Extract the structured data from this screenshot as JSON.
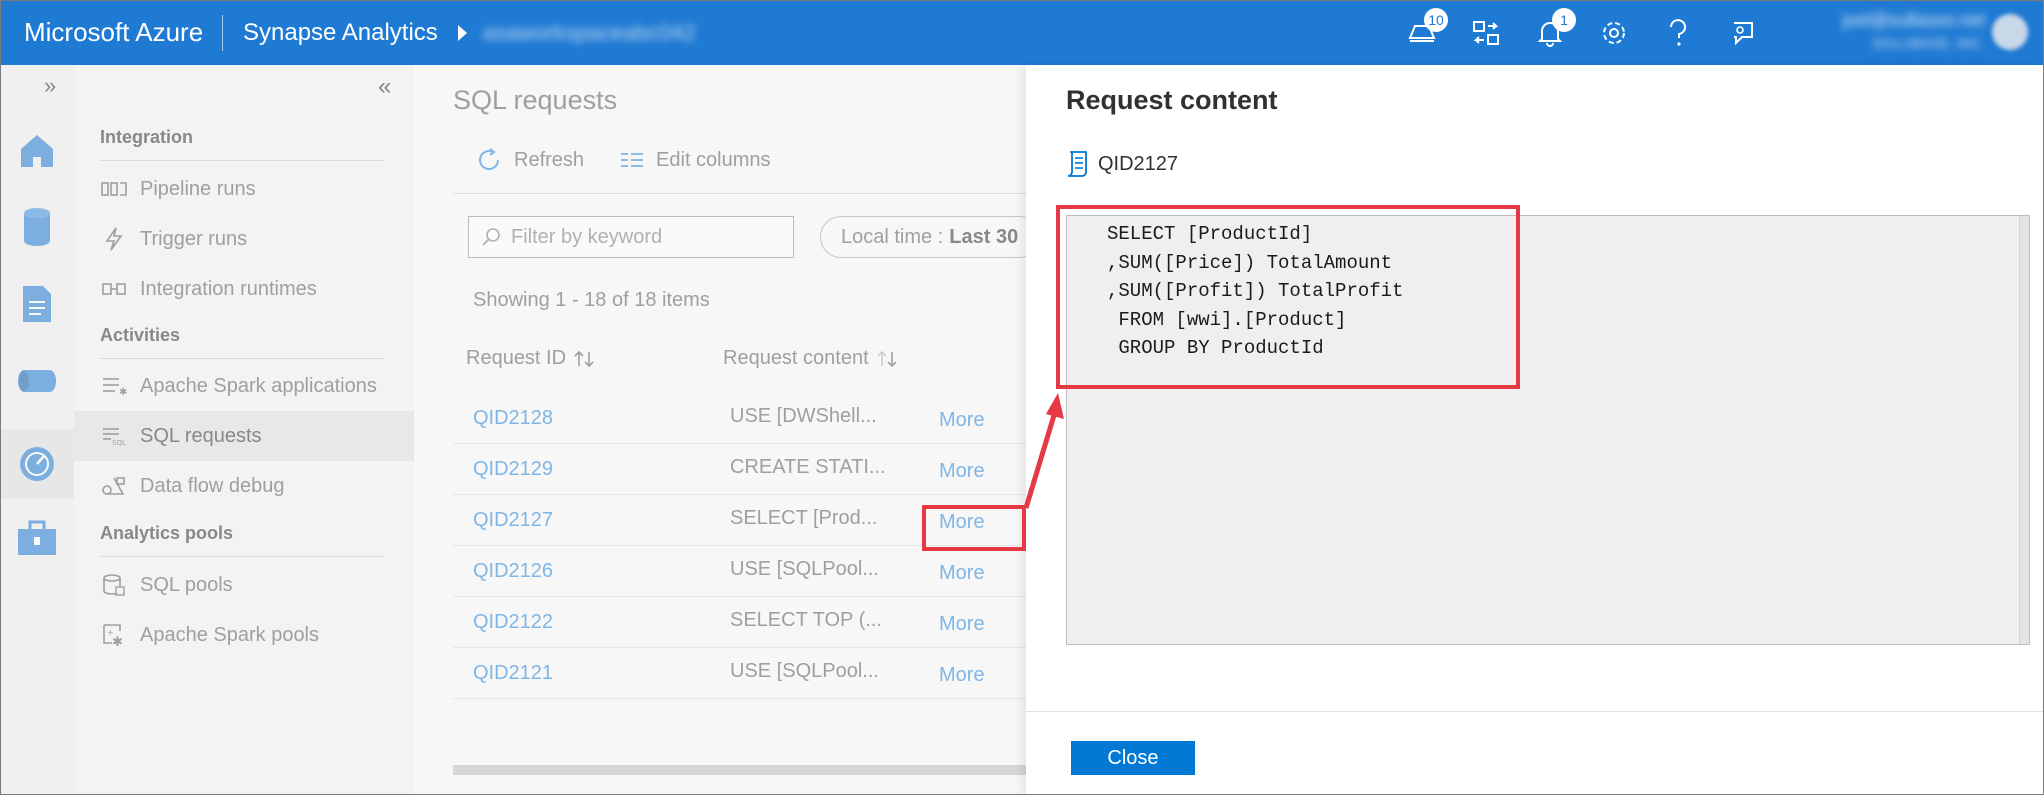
{
  "topbar": {
    "brand": "Microsoft Azure",
    "app": "Synapse Analytics",
    "workspace": "asaworkspaceabc042",
    "notifications_badge": "10",
    "alerts_badge": "1",
    "user_email": "joel@sullasoo.net",
    "user_org": "SOLLIBASE, INC.",
    "icons": [
      "cloud-shell-icon",
      "directory-switch-icon",
      "bell-icon",
      "settings-gear-icon",
      "help-icon",
      "feedback-icon"
    ]
  },
  "rail": {
    "icons": [
      "home-icon",
      "data-icon",
      "develop-icon",
      "integrate-icon",
      "monitor-icon",
      "manage-icon"
    ],
    "active": "monitor-icon"
  },
  "nav": {
    "sections": [
      {
        "title": "Integration",
        "items": [
          "Pipeline runs",
          "Trigger runs",
          "Integration runtimes"
        ]
      },
      {
        "title": "Activities",
        "items": [
          "Apache Spark applications",
          "SQL requests",
          "Data flow debug"
        ]
      },
      {
        "title": "Analytics pools",
        "items": [
          "SQL pools",
          "Apache Spark pools"
        ]
      }
    ],
    "selected": "SQL requests"
  },
  "main": {
    "title": "SQL requests",
    "toolbar": {
      "refresh": "Refresh",
      "edit_columns": "Edit columns"
    },
    "filter_placeholder": "Filter by keyword",
    "time_label": "Local time :",
    "time_value": "Last 30",
    "showing": "Showing 1 - 18 of 18 items",
    "columns": {
      "request_id": "Request ID",
      "request_content": "Request content"
    },
    "rows": [
      {
        "id": "QID2128",
        "content": "USE [DWShell...",
        "more": "More"
      },
      {
        "id": "QID2129",
        "content": "CREATE STATI...",
        "more": "More"
      },
      {
        "id": "QID2127",
        "content": "SELECT [Prod...",
        "more": "More"
      },
      {
        "id": "QID2126",
        "content": "USE [SQLPool...",
        "more": "More"
      },
      {
        "id": "QID2122",
        "content": "SELECT TOP (...",
        "more": "More"
      },
      {
        "id": "QID2121",
        "content": "USE [SQLPool...",
        "more": "More"
      }
    ]
  },
  "panel": {
    "title": "Request content",
    "query_id": "QID2127",
    "code_lines": [
      "SELECT [ProductId]",
      ",SUM([Price]) TotalAmount",
      ",SUM([Profit]) TotalProfit",
      " FROM [wwi].[Product]",
      " GROUP BY ProductId"
    ],
    "close_label": "Close"
  },
  "colors": {
    "topbar": "#1f7ad3",
    "link": "#7fb6e6",
    "primary_button": "#0078d4",
    "annotation": "#e63946"
  }
}
